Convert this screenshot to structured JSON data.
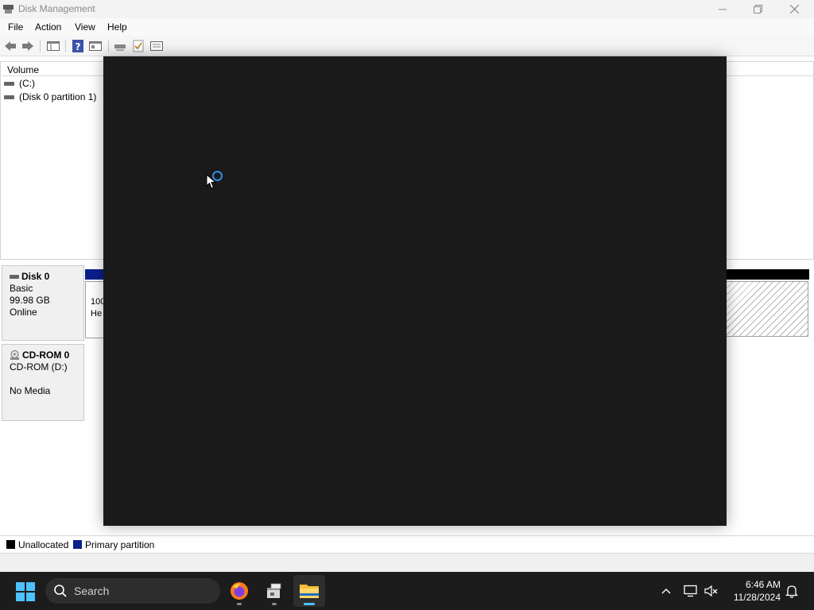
{
  "window": {
    "title": "Disk Management"
  },
  "menu": {
    "items": [
      "File",
      "Action",
      "View",
      "Help"
    ]
  },
  "volumes": {
    "header": "Volume",
    "rows": [
      "(C:)",
      "(Disk 0 partition 1)"
    ]
  },
  "disks": [
    {
      "name": "Disk 0",
      "type": "Basic",
      "size": "99.98 GB",
      "status": "Online",
      "partition_text_1": "100",
      "partition_text_2": "He"
    },
    {
      "name": "CD-ROM 0",
      "type": "CD-ROM (D:)",
      "media": "No Media"
    }
  ],
  "legend": [
    {
      "label": "Unallocated",
      "color": "#000000"
    },
    {
      "label": "Primary partition",
      "color": "#0a1f8a"
    }
  ],
  "taskbar": {
    "search_placeholder": "Search",
    "time": "6:46 AM",
    "date": "11/28/2024",
    "apps": [
      "firefox-icon",
      "package-installer-icon",
      "file-explorer-icon"
    ]
  },
  "colors": {
    "overlay": "#1a1a1a",
    "accent": "#2f8fe0",
    "primary_partition": "#0a1f8a",
    "taskbar": "#1c1c1c"
  }
}
